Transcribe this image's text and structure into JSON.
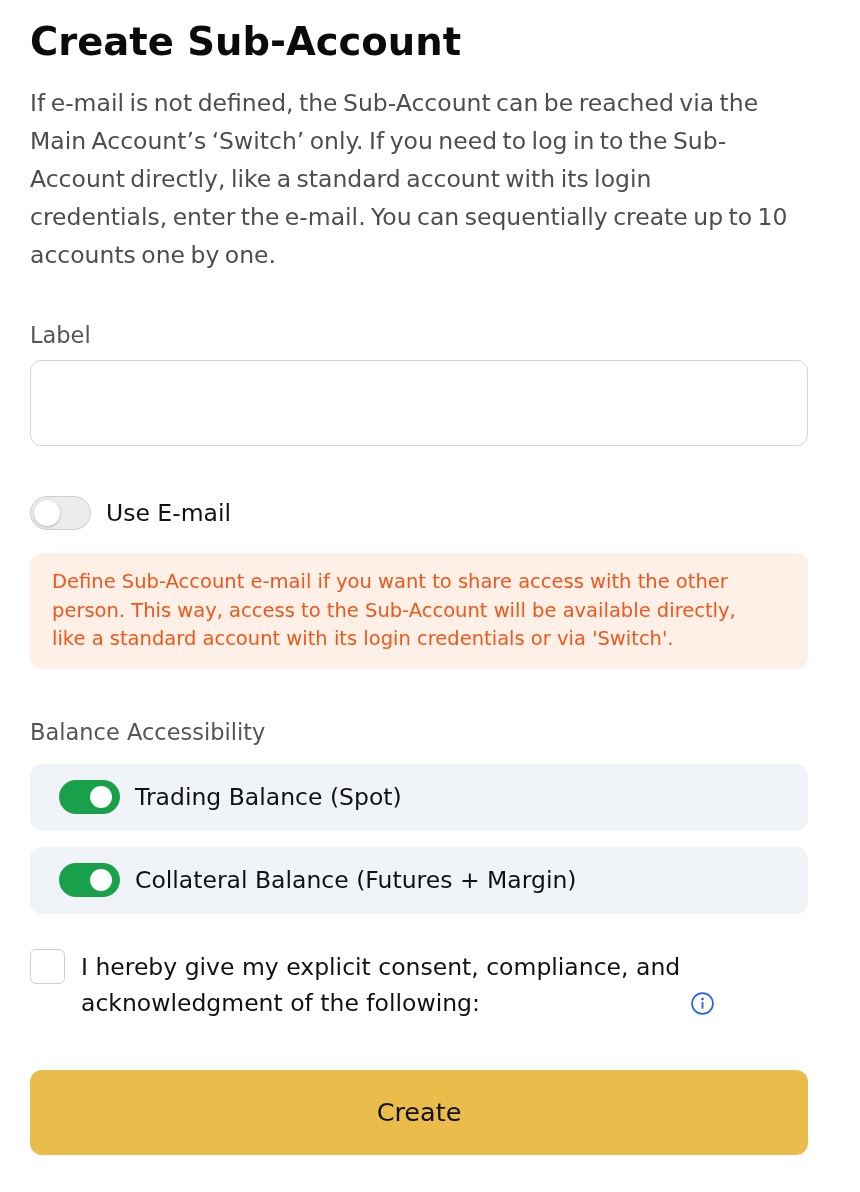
{
  "title": "Create Sub-Account",
  "description": "If e-mail is not defined, the Sub-Account can be reached via the Main Account’s ‘Switch’ only. If you need to log in to the Sub-Account directly, like a standard account with its login credentials, enter the e-mail. You can sequentially create up to 10 accounts one by one.",
  "label_field": {
    "label": "Label"
  },
  "email_toggle": {
    "label": "Use E-mail",
    "on": false
  },
  "notice": "Define Sub-Account e-mail if you want to share access with the other person. This way, access to the Sub-Account will be available directly, like a standard account with its login credentials or via 'Switch'.",
  "balance_accessibility": {
    "heading": "Balance Accessibility",
    "options": [
      {
        "label": "Trading Balance (Spot)",
        "on": true
      },
      {
        "label": "Collateral Balance (Futures + Margin)",
        "on": true
      }
    ]
  },
  "consent": {
    "text": "I hereby give my explicit consent, compliance, and acknowledgment of the following:",
    "checked": false
  },
  "create_button": {
    "label": "Create"
  }
}
